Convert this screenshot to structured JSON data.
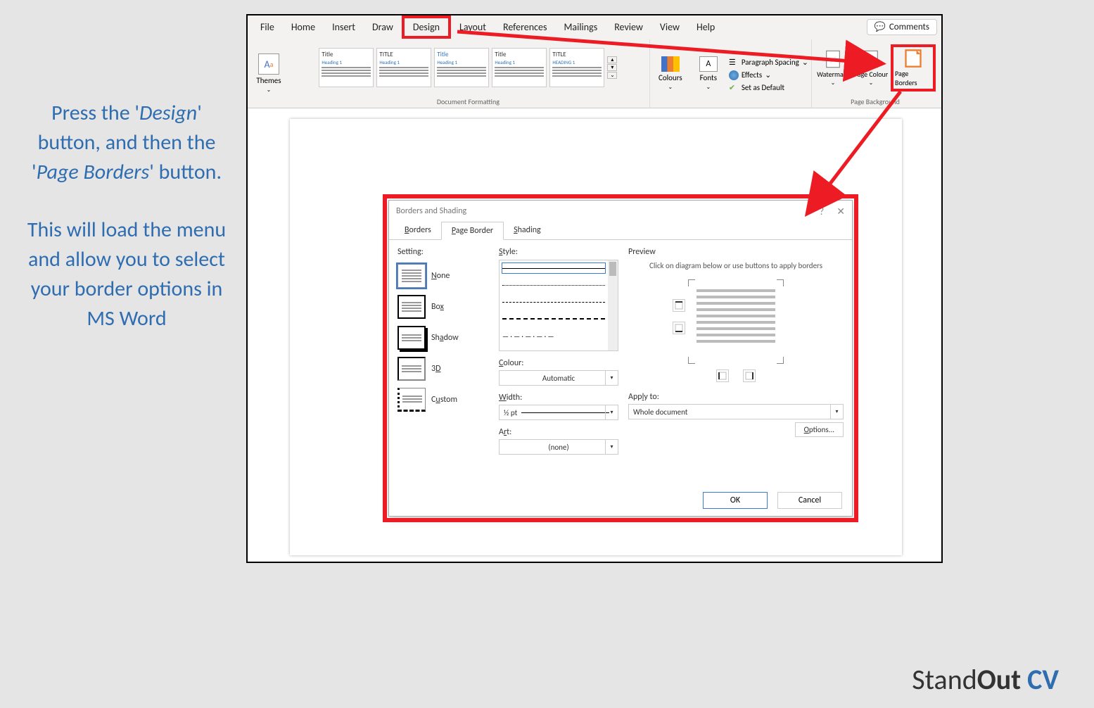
{
  "instruction": {
    "line1a": "Press the '",
    "line1b": "Design",
    "line1c": "' button, and then the '",
    "line1d": "Page Borders",
    "line1e": "' button.",
    "line2": "This will load the menu and allow you to select your border options in MS Word"
  },
  "tabs": [
    "File",
    "Home",
    "Insert",
    "Draw",
    "Design",
    "Layout",
    "References",
    "Mailings",
    "Review",
    "View",
    "Help"
  ],
  "comments_label": "Comments",
  "ribbon": {
    "themes_label": "Themes",
    "themes_icon": "Aa",
    "style_thumbs": [
      {
        "title": "Title",
        "heading": "Heading 1"
      },
      {
        "title": "TITLE",
        "heading": "Heading 1"
      },
      {
        "title": "Title",
        "heading": "Heading 1"
      },
      {
        "title": "Title",
        "heading": "Heading 1"
      },
      {
        "title": "TITLE",
        "heading": "HEADING 1"
      }
    ],
    "doc_fmt_label": "Document Formatting",
    "colours_label": "Colours",
    "fonts_label": "Fonts",
    "fonts_icon": "A",
    "paragraph_spacing": "Paragraph Spacing",
    "effects": "Effects",
    "set_default": "Set as Default",
    "watermark": "Watermark",
    "page_colour": "Page Colour",
    "page_borders": "Page Borders",
    "page_bg_label": "Page Background"
  },
  "dialog": {
    "title": "Borders and Shading",
    "help": "?",
    "close": "✕",
    "tabs": {
      "borders": "Borders",
      "page_border": "Page Border",
      "shading": "Shading"
    },
    "setting_label": "Setting:",
    "settings": {
      "none": "None",
      "box": "Box",
      "shadow": "Shadow",
      "threeD": "3D",
      "custom": "Custom"
    },
    "style_label": "Style:",
    "colour_label": "Colour:",
    "colour_value": "Automatic",
    "width_label": "Width:",
    "width_value": "½ pt",
    "art_label": "Art:",
    "art_value": "(none)",
    "preview_label": "Preview",
    "preview_hint": "Click on diagram below or use buttons to apply borders",
    "apply_label": "Apply to:",
    "apply_value": "Whole document",
    "options": "Options...",
    "ok": "OK",
    "cancel": "Cancel"
  },
  "logo": {
    "a": "Stand",
    "b": "Out",
    "c": " CV"
  }
}
